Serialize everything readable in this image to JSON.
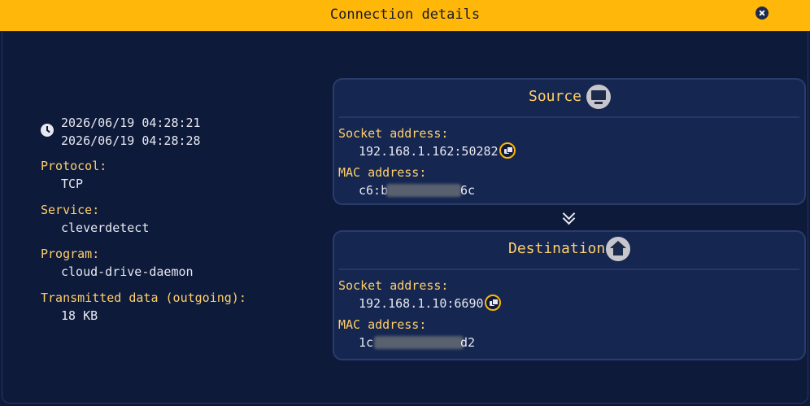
{
  "window": {
    "title": "Connection details"
  },
  "overview": {
    "timestamps": [
      "2026/06/19 04:28:21",
      "2026/06/19 04:28:28"
    ],
    "protocol_label": "Protocol:",
    "protocol_value": "TCP",
    "service_label": "Service:",
    "service_value": "cleverdetect",
    "program_label": "Program:",
    "program_value": "cloud-drive-daemon",
    "transmitted_label": "Transmitted data (outgoing):",
    "transmitted_value": "18 KB"
  },
  "source": {
    "title": "Source",
    "icon": "monitor-icon",
    "socket_label": "Socket address:",
    "socket_value": "192.168.1.162:50282",
    "mac_label": "MAC address:",
    "mac_prefix": "c6:b",
    "mac_suffix": "6c"
  },
  "destination": {
    "title": "Destination",
    "icon": "home-icon",
    "socket_label": "Socket address:",
    "socket_value": "192.168.1.10:6690",
    "mac_label": "MAC address:",
    "mac_prefix": "1c",
    "mac_suffix": "d2"
  },
  "colors": {
    "accent": "#ffb70a",
    "label": "#ffcf6a",
    "background": "#0d1a3a",
    "card": "#152650"
  }
}
